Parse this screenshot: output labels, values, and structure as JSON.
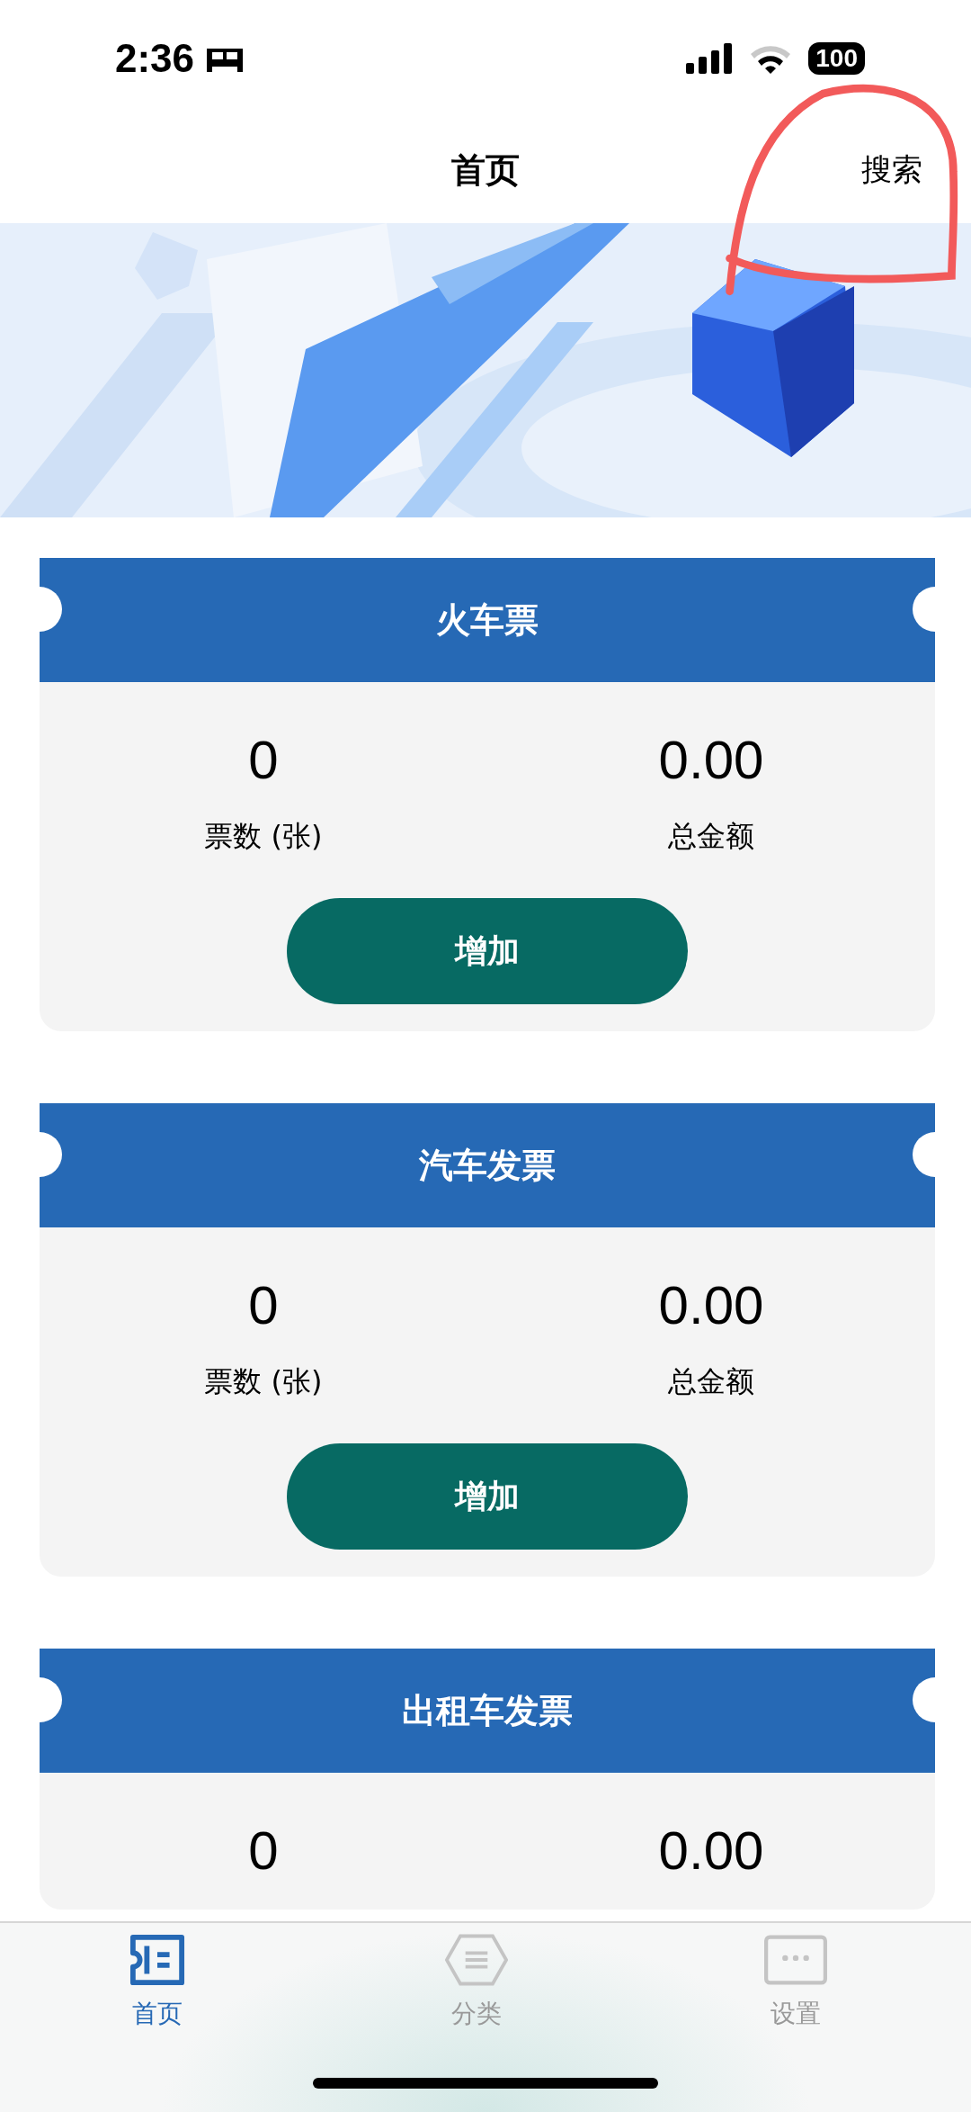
{
  "status_bar": {
    "time": "2:36",
    "battery": "100"
  },
  "nav": {
    "title": "首页",
    "action": "搜索"
  },
  "cards": [
    {
      "title": "火车票",
      "stats": [
        {
          "value": "0",
          "label": "票数 (张)"
        },
        {
          "value": "0.00",
          "label": "总金额"
        }
      ],
      "button": "增加"
    },
    {
      "title": "汽车发票",
      "stats": [
        {
          "value": "0",
          "label": "票数 (张)"
        },
        {
          "value": "0.00",
          "label": "总金额"
        }
      ],
      "button": "增加"
    },
    {
      "title": "出租车发票",
      "stats": [
        {
          "value": "0"
        },
        {
          "value": "0.00"
        }
      ]
    }
  ],
  "tabs": [
    {
      "label": "首页",
      "selected": true
    },
    {
      "label": "分类",
      "selected": false
    },
    {
      "label": "设置",
      "selected": false
    }
  ]
}
